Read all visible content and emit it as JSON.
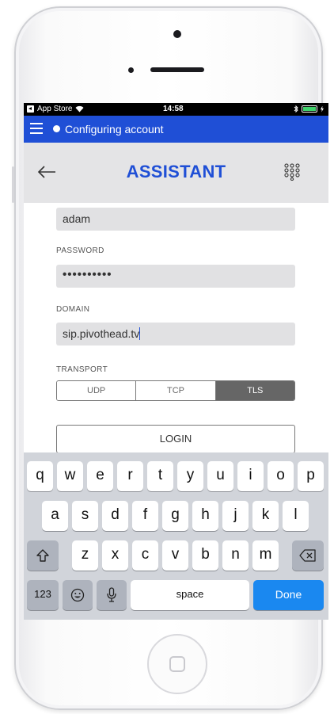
{
  "status_bar": {
    "back_app": "App Store",
    "time": "14:58",
    "colors": {
      "battery": "#3fd26b"
    }
  },
  "app_bar": {
    "status_text": "Configuring account",
    "color": "#1f4fd6"
  },
  "header": {
    "title": "ASSISTANT",
    "back_icon": "arrow-left-icon",
    "dialpad_icon": "dialpad-icon"
  },
  "form": {
    "username_value": "adam",
    "password_label": "PASSWORD",
    "password_value": "••••••••••",
    "domain_label": "DOMAIN",
    "domain_value": "sip.pivothead.tv",
    "transport_label": "TRANSPORT",
    "transport_options": [
      "UDP",
      "TCP",
      "TLS"
    ],
    "transport_selected": "TLS",
    "login_label": "LOGIN"
  },
  "keyboard": {
    "row1": [
      "q",
      "w",
      "e",
      "r",
      "t",
      "y",
      "u",
      "i",
      "o",
      "p"
    ],
    "row2": [
      "a",
      "s",
      "d",
      "f",
      "g",
      "h",
      "j",
      "k",
      "l"
    ],
    "row3": [
      "z",
      "x",
      "c",
      "v",
      "b",
      "n",
      "m"
    ],
    "numbers_label": "123",
    "space_label": "space",
    "done_label": "Done",
    "icons": {
      "shift": "shift-icon",
      "backspace": "backspace-icon",
      "emoji": "emoji-icon",
      "mic": "microphone-icon"
    },
    "done_color": "#1a88f0"
  }
}
